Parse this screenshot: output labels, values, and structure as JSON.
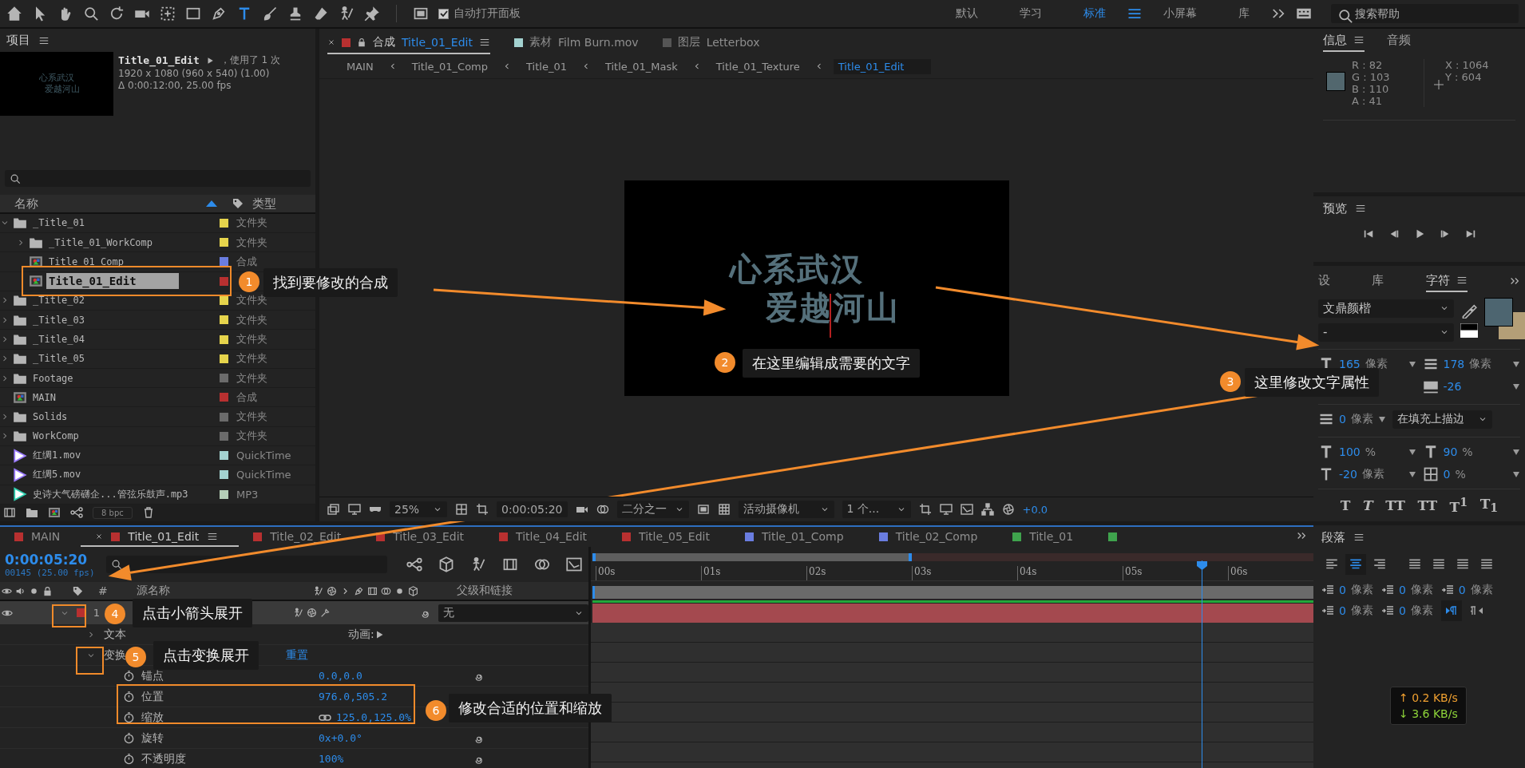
{
  "toolbar": {
    "auto_open": {
      "label": "自动打开面板",
      "checked": true
    },
    "workspaces": [
      {
        "label": "默认",
        "selected": false
      },
      {
        "label": "学习",
        "selected": false
      },
      {
        "label": "标准",
        "selected": true
      },
      {
        "label": "小屏幕",
        "selected": false
      },
      {
        "label": "库",
        "selected": false
      }
    ],
    "search": {
      "placeholder": "搜索帮助"
    }
  },
  "project": {
    "title": "项目",
    "preview": {
      "thumbnail_lines": [
        "心系武汉",
        "爱越河山"
      ],
      "name": "Title_01_Edit",
      "usage": "，使用了 1 次",
      "dimensions": "1920 x 1080  (960 x 540) (1.00)",
      "duration": "Δ 0:00:12:00, 25.00 fps"
    },
    "columns": {
      "name": "名称",
      "type": "类型"
    },
    "items": [
      {
        "name": "_Title_01",
        "kind": "folder",
        "expanded": true,
        "color": "#e6d44c",
        "type": "文件夹",
        "selected": false,
        "children": [
          {
            "name": "_Title_01_WorkComp",
            "kind": "folder",
            "expanded": false,
            "color": "#e6d44c",
            "type": "文件夹",
            "selected": false
          },
          {
            "name": "Title_01_Comp",
            "kind": "comp",
            "color": "#6a7de0",
            "type": "合成",
            "selected": false
          },
          {
            "name": "Title_01_Edit",
            "kind": "comp",
            "color": "#b83030",
            "selected": true
          }
        ]
      },
      {
        "name": "_Title_02",
        "kind": "folder",
        "expanded": false,
        "color": "#e6d44c",
        "type": "文件夹",
        "selected": false
      },
      {
        "name": "_Title_03",
        "kind": "folder",
        "expanded": false,
        "color": "#e6d44c",
        "type": "文件夹",
        "selected": false
      },
      {
        "name": "_Title_04",
        "kind": "folder",
        "expanded": false,
        "color": "#e6d44c",
        "type": "文件夹",
        "selected": false
      },
      {
        "name": "_Title_05",
        "kind": "folder",
        "expanded": false,
        "color": "#e6d44c",
        "type": "文件夹",
        "selected": false
      },
      {
        "name": "Footage",
        "kind": "folder",
        "expanded": false,
        "color": "#6b6b6b",
        "type": "文件夹",
        "selected": false
      },
      {
        "name": "MAIN",
        "kind": "comp",
        "color": "#b83030",
        "type": "合成",
        "selected": false
      },
      {
        "name": "Solids",
        "kind": "folder",
        "expanded": false,
        "color": "#6b6b6b",
        "type": "文件夹",
        "selected": false
      },
      {
        "name": "WorkComp",
        "kind": "folder",
        "expanded": false,
        "color": "#6b6b6b",
        "type": "文件夹",
        "selected": false
      },
      {
        "name": "红绸1.mov",
        "kind": "video",
        "color": "#a3d2d0",
        "type": "QuickTime",
        "selected": false
      },
      {
        "name": "红绸5.mov",
        "kind": "video",
        "color": "#a3d2d0",
        "type": "QuickTime",
        "selected": false
      },
      {
        "name": "史诗大气磅礴企...管弦乐鼓声.mp3",
        "kind": "audio",
        "color": "#b5cfb8",
        "type": "MP3",
        "selected": false
      }
    ],
    "bit_depth": "8 bpc"
  },
  "viewer": {
    "tabs": [
      {
        "prefix": "合成",
        "name": "Title_01_Edit",
        "selected": true,
        "color": "#b83030"
      },
      {
        "prefix": "素材",
        "name": "Film Burn.mov",
        "selected": false,
        "color": "#a3d2d0"
      },
      {
        "prefix": "图层",
        "name": "Letterbox",
        "selected": false,
        "color": "#555555"
      }
    ],
    "breadcrumbs": [
      {
        "label": "MAIN",
        "selected": false
      },
      {
        "label": "Title_01_Comp",
        "selected": false
      },
      {
        "label": "Title_01",
        "selected": false
      },
      {
        "label": "Title_01_Mask",
        "selected": false
      },
      {
        "label": "Title_01_Texture",
        "selected": false
      },
      {
        "label": "Title_01_Edit",
        "selected": true
      }
    ],
    "comp_text": [
      "心系武汉",
      "爱越河山"
    ],
    "controls": {
      "zoom": "25%",
      "time": "0:00:05:20",
      "resolution": "二分之一",
      "camera": "活动摄像机",
      "views": "1 个...",
      "exposure": "+0.0"
    }
  },
  "info": {
    "tabs": [
      {
        "label": "信息",
        "selected": true
      },
      {
        "label": "音频",
        "selected": false
      }
    ],
    "channels": [
      "R : 82",
      "G : 103",
      "B : 110",
      "A : 41"
    ],
    "coords": [
      "X : 1064",
      "Y : 604"
    ]
  },
  "preview": {
    "title": "预览"
  },
  "character": {
    "tabs": [
      {
        "label": "设",
        "selected": false
      },
      {
        "label": "库",
        "selected": false
      },
      {
        "label": "字符",
        "selected": true
      }
    ],
    "font": "文鼎颜楷",
    "style": "-",
    "size": {
      "value": "165",
      "unit": "像素"
    },
    "leading": {
      "value": "178",
      "unit": "像素"
    },
    "tracking": {
      "value": "-26"
    },
    "stroke_width": {
      "value": "0",
      "unit": "像素"
    },
    "stroke_mode": "在填充上描边",
    "vertical_scale": {
      "value": "100",
      "unit": "%"
    },
    "horizontal_scale": {
      "value": "90",
      "unit": "%"
    },
    "baseline_shift": {
      "value": "-20",
      "unit": "像素"
    },
    "tsume": {
      "value": "0",
      "unit": "%"
    },
    "style_buttons": [
      {
        "label": "T",
        "kind": "bold"
      },
      {
        "label": "T",
        "kind": "italic"
      },
      {
        "label": "TT",
        "kind": "caps"
      },
      {
        "label": "TT",
        "kind": "smallcaps"
      },
      {
        "label": "T$^{1}$",
        "kind": "super"
      },
      {
        "label": "T$_{1}$",
        "kind": "sub"
      }
    ]
  },
  "timeline": {
    "tabs": [
      {
        "label": "MAIN",
        "color": "#b83030",
        "selected": false
      },
      {
        "label": "Title_01_Edit",
        "color": "#b83030",
        "selected": true
      },
      {
        "label": "Title_02_Edit",
        "color": "#b83030",
        "selected": false
      },
      {
        "label": "Title_03_Edit",
        "color": "#b83030",
        "selected": false
      },
      {
        "label": "Title_04_Edit",
        "color": "#b83030",
        "selected": false
      },
      {
        "label": "Title_05_Edit",
        "color": "#b83030",
        "selected": false
      },
      {
        "label": "Title_01_Comp",
        "color": "#6a7de0",
        "selected": false
      },
      {
        "label": "Title_02_Comp",
        "color": "#6a7de0",
        "selected": false
      },
      {
        "label": "Title_01",
        "color": "#3fa34d",
        "selected": false
      },
      {
        "color": "#3fa34d",
        "selected": false
      }
    ],
    "time": "0:00:05:20",
    "frame": "00145 (25.00 fps)",
    "columns": {
      "number": "#",
      "source": "源名称",
      "parent": "父级和链接"
    },
    "layer": {
      "number": "1",
      "parent": "无",
      "expanded": true
    },
    "properties": [
      {
        "label": "文本",
        "kind": "group",
        "expanded": false,
        "extra": "动画:"
      },
      {
        "label": "变换",
        "kind": "group",
        "expanded": true,
        "extra": "重置"
      },
      {
        "label": "锚点",
        "kind": "prop",
        "value": "0.0,0.0"
      },
      {
        "label": "位置",
        "kind": "prop",
        "value": "976.0,505.2"
      },
      {
        "label": "缩放",
        "kind": "prop",
        "value": "125.0,125.0%",
        "linked": true
      },
      {
        "label": "旋转",
        "kind": "prop",
        "value": "0x+0.0°"
      },
      {
        "label": "不透明度",
        "kind": "prop",
        "value": "100%"
      }
    ],
    "ruler": [
      "00s",
      "01s",
      "02s",
      "03s",
      "04s",
      "05s",
      "06s"
    ]
  },
  "paragraph": {
    "title": "段落",
    "alignments": [
      {
        "kind": "left",
        "selected": false
      },
      {
        "kind": "center",
        "selected": true
      },
      {
        "kind": "right",
        "selected": false
      },
      {
        "kind": "justify",
        "selected": false
      },
      {
        "kind": "justify",
        "selected": false
      },
      {
        "kind": "justify",
        "selected": false
      },
      {
        "kind": "justify",
        "selected": false
      }
    ],
    "indents": [
      {
        "value": "0",
        "unit": "像素"
      },
      {
        "value": "0",
        "unit": "像素"
      },
      {
        "value": "0",
        "unit": "像素"
      },
      {
        "value": "0",
        "unit": "像素"
      },
      {
        "value": "0",
        "unit": "像素"
      }
    ],
    "directions": [
      {
        "kind": "ltr",
        "selected": true
      },
      {
        "kind": "rtl",
        "selected": false
      }
    ]
  },
  "network": {
    "upload": "↑ 0.2 KB/s",
    "download": "↓ 3.6 KB/s"
  },
  "steps": [
    {
      "number": "1",
      "text": "找到要修改的合成"
    },
    {
      "number": "2",
      "text": "在这里编辑成需要的文字"
    },
    {
      "number": "3",
      "text": "这里修改文字属性"
    },
    {
      "number": "4",
      "text": "点击小箭头展开"
    },
    {
      "number": "5",
      "text": "点击变换展开"
    },
    {
      "number": "6",
      "text": "修改合适的位置和缩放"
    }
  ]
}
